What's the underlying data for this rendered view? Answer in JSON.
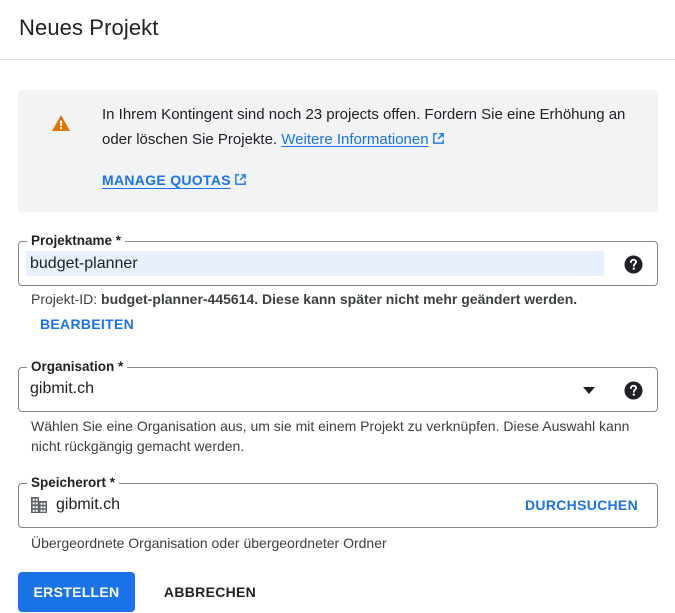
{
  "header": {
    "title": "Neues Projekt"
  },
  "notice": {
    "text": "In Ihrem Kontingent sind noch 23 projects offen. Fordern Sie eine Erhöhung an oder löschen Sie Projekte. ",
    "link_label": "Weitere Informationen",
    "manage_label": "MANAGE QUOTAS"
  },
  "project_name": {
    "label": "Projektname *",
    "value": "budget-planner",
    "hint_prefix": "Projekt-ID: ",
    "hint_id": "budget-planner-445614. Diese kann später nicht mehr geändert werden.",
    "edit_label": "BEARBEITEN"
  },
  "organisation": {
    "label": "Organisation *",
    "value": "gibmit.ch",
    "hint": "Wählen Sie eine Organisation aus, um sie mit einem Projekt zu verknüpfen. Diese Auswahl kann nicht rückgängig gemacht werden."
  },
  "location": {
    "label": "Speicherort *",
    "value": "gibmit.ch",
    "browse_label": "DURCHSUCHEN",
    "hint": "Übergeordnete Organisation oder übergeordneter Ordner"
  },
  "actions": {
    "create_label": "ERSTELLEN",
    "cancel_label": "ABBRECHEN"
  },
  "colors": {
    "accent": "#1a73e8",
    "warning": "#e37400",
    "notice_bg": "#f1f3f4",
    "selection": "#e8f0fe"
  },
  "icons": {
    "warning": "warning-icon",
    "external": "external-link-icon",
    "help": "help-icon",
    "dropdown": "dropdown-arrow-icon",
    "building": "building-icon"
  }
}
